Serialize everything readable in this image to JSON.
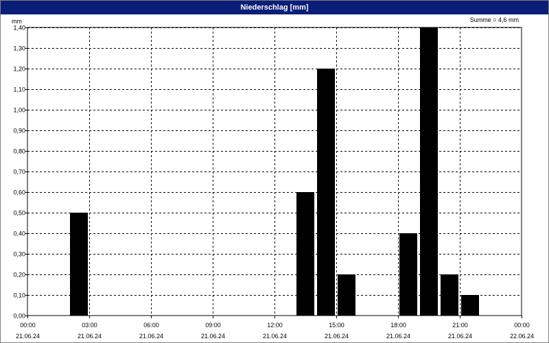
{
  "window": {
    "title": "Niederschlag [mm]"
  },
  "chart_data": {
    "type": "bar",
    "title": "Niederschlag [mm]",
    "annotation": "Summe = 4,6 mm",
    "ylabel": "mm",
    "xlabel": "",
    "ylim": [
      0,
      1.4
    ],
    "y_ticks": [
      "0,00",
      "0,10",
      "0,20",
      "0,30",
      "0,40",
      "0,50",
      "0,60",
      "0,70",
      "0,80",
      "0,90",
      "1,00",
      "1,10",
      "1,20",
      "1,30",
      "1,40"
    ],
    "xlim_hours": [
      0,
      24
    ],
    "x_ticks": [
      {
        "time": "00:00",
        "date": "21.06.24"
      },
      {
        "time": "03:00",
        "date": "21.06.24"
      },
      {
        "time": "06:00",
        "date": "21.06.24"
      },
      {
        "time": "09:00",
        "date": "21.06.24"
      },
      {
        "time": "12:00",
        "date": "21.06.24"
      },
      {
        "time": "15:00",
        "date": "21.06.24"
      },
      {
        "time": "18:00",
        "date": "21.06.24"
      },
      {
        "time": "21:00",
        "date": "21.06.24"
      },
      {
        "time": "00:00",
        "date": "22.06.24"
      }
    ],
    "interval_hours": 1,
    "series": [
      {
        "bars": [
          {
            "start": "02:00",
            "value": 0.5
          },
          {
            "start": "13:00",
            "value": 0.6
          },
          {
            "start": "14:00",
            "value": 1.2
          },
          {
            "start": "15:00",
            "value": 0.2
          },
          {
            "start": "18:00",
            "value": 0.4
          },
          {
            "start": "19:00",
            "value": 1.4
          },
          {
            "start": "20:00",
            "value": 0.2
          },
          {
            "start": "21:00",
            "value": 0.1
          }
        ]
      }
    ],
    "bar_color": "#000000",
    "grid": true,
    "grid_style": "dashed"
  }
}
